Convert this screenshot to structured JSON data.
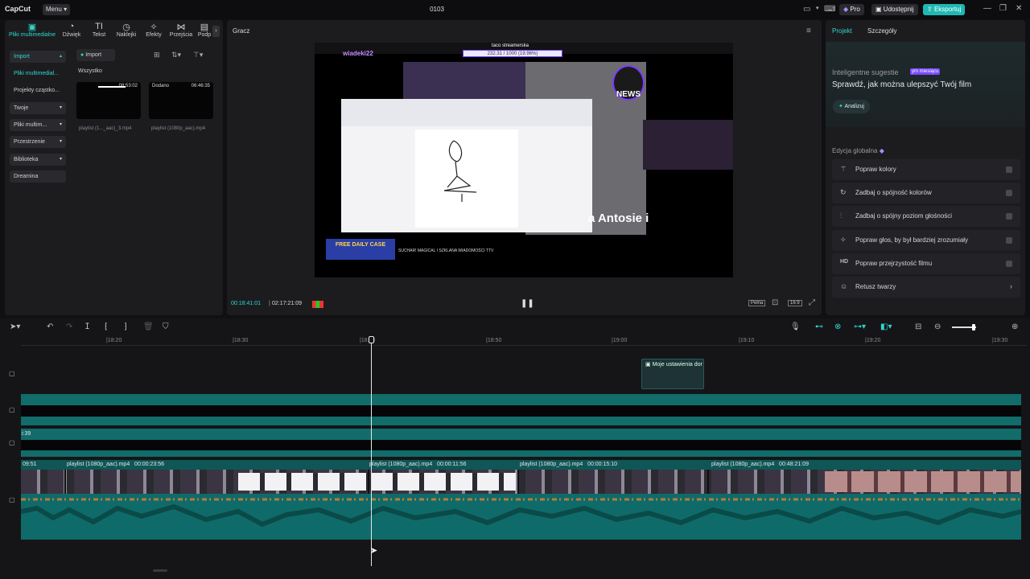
{
  "app": {
    "logo": "CapCut",
    "menu_label": "Menu",
    "project_title": "0103"
  },
  "titlebar": {
    "pro_label": "Pro",
    "share_label": "Udostępnij",
    "export_label": "Eksportuj",
    "accent": "#2fd8d0"
  },
  "media_tabs": [
    {
      "label": "Pliki multimedialne",
      "icon": "media-icon",
      "active": true
    },
    {
      "label": "Dźwięk",
      "icon": "audio-icon"
    },
    {
      "label": "Tekst",
      "icon": "text-icon"
    },
    {
      "label": "Naklejki",
      "icon": "sticker-icon"
    },
    {
      "label": "Efekty",
      "icon": "effects-icon"
    },
    {
      "label": "Przejścia",
      "icon": "transitions-icon"
    },
    {
      "label": "Podp",
      "icon": "captions-icon"
    }
  ],
  "sidebar": {
    "import": "Import",
    "media": "Pliki multimedial...",
    "projects": "Projekty cząstko...",
    "yours": "Twoje",
    "media2": "Pliki multim...",
    "spaces": "Przestrzenie",
    "library": "Biblioteka",
    "dreamina": "Dreamina"
  },
  "media": {
    "import_button": "Import",
    "filter": "Wszystko",
    "clips": [
      {
        "name": "playlist (1..._aac)_3.mp4",
        "duration": "08:53:02",
        "badge": ""
      },
      {
        "name": "playlist (1080p_aac).mp4",
        "duration": "06:46:35",
        "badge": "Dodano"
      }
    ]
  },
  "player": {
    "title": "Gracz",
    "current_time": "00:18:41:01",
    "total_time": "02:17:21:09",
    "full_label": "Pełna",
    "ratio_label": "16:9",
    "overlay": {
      "stream_title": "taco streamerska",
      "stream_counter": "232.31 / 1000 (19.96%)",
      "channel_tag": "wiadeki22",
      "news_label": "NEWS",
      "lower_text": "a Antosie i",
      "ticker": "SUCHAR! MAGICAL I SZKLANA WIADOMOŚCI TTV",
      "ad_label": "FREE DAILY CASE"
    }
  },
  "right_panel": {
    "tab_project": "Projekt",
    "tab_details": "Szczegóły",
    "suggest_title": "Inteligentne sugestie",
    "suggest_badge": "ym miesiącu",
    "suggest_heading": "Sprawdź, jak można ulepszyć Twój film",
    "analyze": "Analizuj",
    "global_title": "Edycja globalna",
    "items": [
      {
        "label": "Popraw kolory",
        "icon": "magic-wand-icon"
      },
      {
        "label": "Zadbaj o spójność kolorów",
        "icon": "color-match-icon"
      },
      {
        "label": "Zadbaj o spójny poziom głośności",
        "icon": "volume-level-icon"
      },
      {
        "label": "Popraw głos, by był bardziej zrozumiały",
        "icon": "voice-enhance-icon"
      },
      {
        "label": "Popraw przejrzystość filmu",
        "icon": "hd-icon"
      },
      {
        "label": "Retusz twarzy",
        "icon": "face-retouch-icon"
      }
    ]
  },
  "timeline": {
    "ruler": [
      "|18:20",
      "|18:30",
      "|18:40",
      "|18:50",
      "|19:00",
      "|19:10",
      "|19:20",
      "|19:30"
    ],
    "text_clip": "Moje ustawienia dor",
    "track_left_label": "i:39",
    "video_clips": [
      {
        "label": "09:51"
      },
      {
        "label": "playlist (1080p_aac).mp4   00:00:23:56"
      },
      {
        "label": "playlist (1080p_aac).mp4   00:00:11:56"
      },
      {
        "label": "playlist (1080p_aac).mp4   00:00:15:10"
      },
      {
        "label": "playlist (1080p_aac).mp4   00:48:21:09"
      }
    ]
  }
}
